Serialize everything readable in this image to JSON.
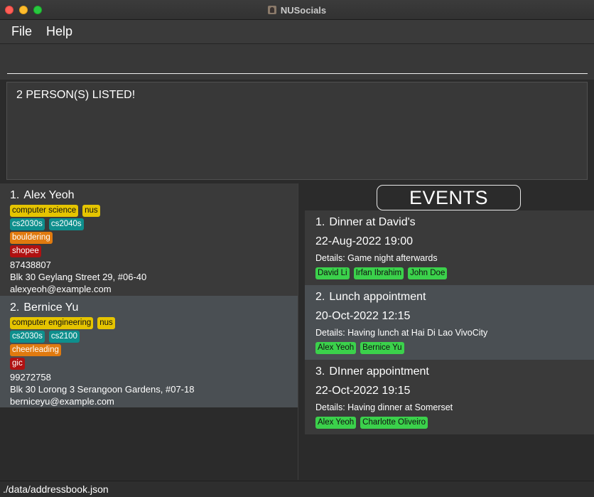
{
  "window": {
    "title": "NUSocials"
  },
  "menu": {
    "file": "File",
    "help": "Help"
  },
  "command": {
    "value": ""
  },
  "result": {
    "text": "2 PERSON(S) LISTED!"
  },
  "persons": [
    {
      "index": "1.",
      "name": "Alex Yeoh",
      "tag_rows": [
        [
          {
            "text": "computer science",
            "color": "yellow"
          },
          {
            "text": "nus",
            "color": "yellow"
          }
        ],
        [
          {
            "text": "cs2030s",
            "color": "teal"
          },
          {
            "text": "cs2040s",
            "color": "teal"
          }
        ],
        [
          {
            "text": "bouldering",
            "color": "orange"
          }
        ],
        [
          {
            "text": "shopee",
            "color": "red"
          }
        ]
      ],
      "phone": "87438807",
      "address": "Blk 30 Geylang Street 29, #06-40",
      "email": "alexyeoh@example.com"
    },
    {
      "index": "2.",
      "name": "Bernice Yu",
      "tag_rows": [
        [
          {
            "text": "computer engineering",
            "color": "yellow"
          },
          {
            "text": "nus",
            "color": "yellow"
          }
        ],
        [
          {
            "text": "cs2030s",
            "color": "teal"
          },
          {
            "text": "cs2100",
            "color": "teal"
          }
        ],
        [
          {
            "text": "cheerleading",
            "color": "orange"
          }
        ],
        [
          {
            "text": "gic",
            "color": "red"
          }
        ]
      ],
      "phone": "99272758",
      "address": "Blk 30 Lorong 3 Serangoon Gardens, #07-18",
      "email": "berniceyu@example.com"
    }
  ],
  "events_header": "EVENTS",
  "events": [
    {
      "index": "1.",
      "name": "Dinner at David's",
      "datetime": "22-Aug-2022 19:00",
      "details": "Details: Game night afterwards",
      "attendees": [
        "David Li",
        "Irfan Ibrahim",
        "John Doe"
      ]
    },
    {
      "index": "2.",
      "name": "Lunch appointment",
      "datetime": "20-Oct-2022 12:15",
      "details": "Details: Having lunch at Hai Di Lao VivoCity",
      "attendees": [
        "Alex Yeoh",
        "Bernice Yu"
      ]
    },
    {
      "index": "3.",
      "name": "DInner appointment",
      "datetime": "22-Oct-2022 19:15",
      "details": "Details: Having dinner at Somerset",
      "attendees": [
        "Alex Yeoh",
        "Charlotte Oliveiro"
      ]
    }
  ],
  "status": {
    "path": "./data/addressbook.json"
  },
  "colors": {
    "tag_yellow": "#e5c400",
    "tag_teal": "#0e8f8d",
    "tag_orange": "#e07a0f",
    "tag_red": "#b01111",
    "tag_green": "#3bd14b"
  }
}
